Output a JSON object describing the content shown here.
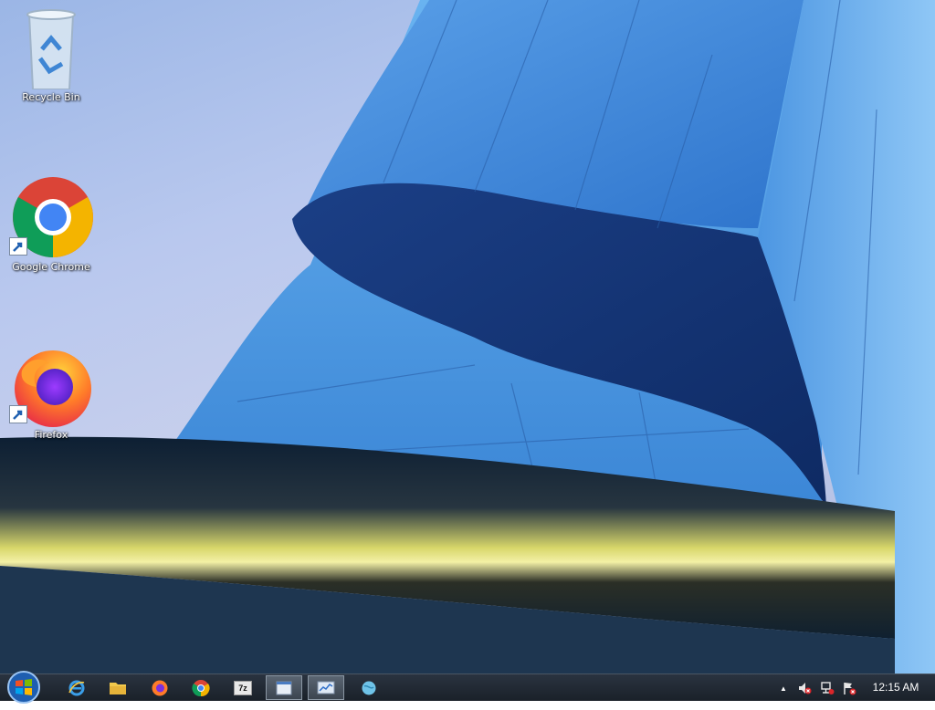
{
  "desktop": {
    "icons": [
      {
        "label": "Recycle Bin",
        "icon": "recycle-bin-icon"
      },
      {
        "label": "Google Chrome",
        "icon": "chrome-icon"
      },
      {
        "label": "Firefox",
        "icon": "firefox-icon"
      }
    ]
  },
  "taskbar": {
    "start": {
      "icon": "windows-logo-icon"
    },
    "pinned": [
      {
        "icon": "internet-explorer-icon"
      },
      {
        "icon": "file-explorer-icon"
      },
      {
        "icon": "firefox-icon"
      },
      {
        "icon": "chrome-icon"
      },
      {
        "icon": "7zip-icon",
        "text": "7z"
      },
      {
        "icon": "window-app-icon"
      },
      {
        "icon": "performance-monitor-icon"
      },
      {
        "icon": "globe-app-icon"
      }
    ],
    "tray": {
      "chevron": "▲",
      "clock": "12:15 AM"
    }
  },
  "colors": {
    "accent_blue": "#2f6fc9",
    "taskbar_bg": "#1f2730"
  }
}
